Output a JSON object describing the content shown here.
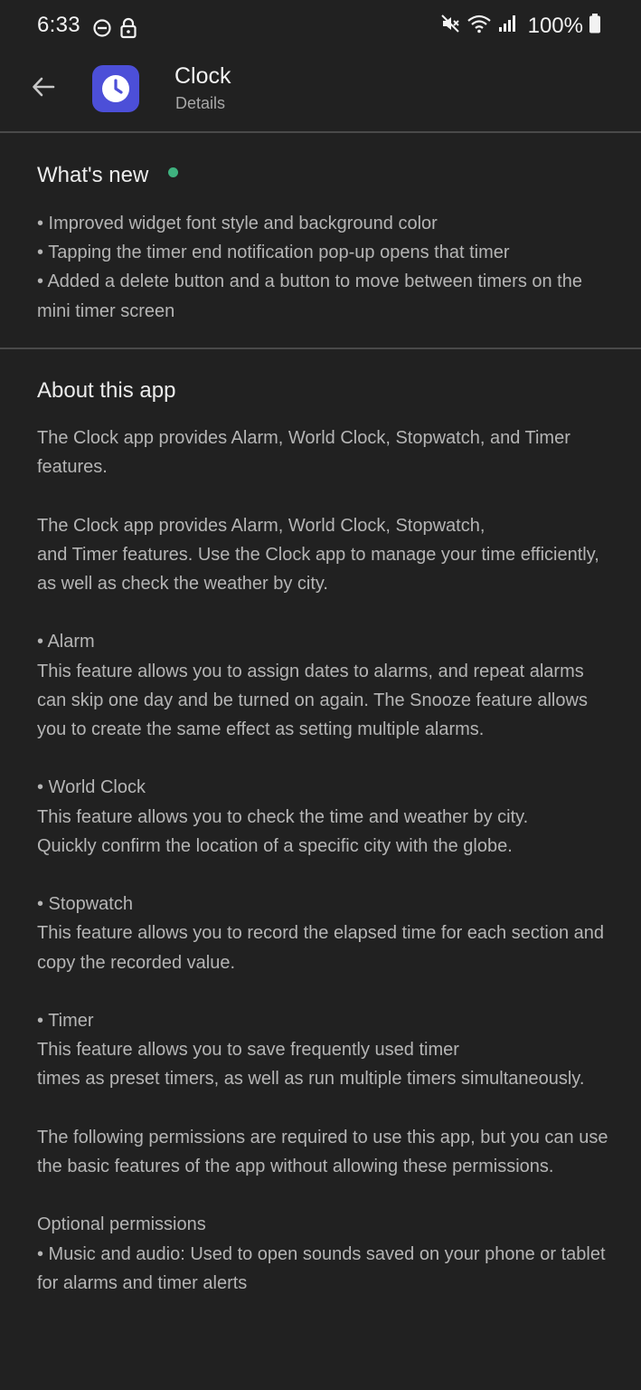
{
  "status_bar": {
    "time": "6:33",
    "left_icons": [
      "do-not-disturb-icon",
      "lock-icon"
    ],
    "right_icons": [
      "mute-icon",
      "wifi-icon",
      "signal-icon",
      "battery-icon"
    ],
    "battery": "100%"
  },
  "header": {
    "back_icon": "arrow-left-icon",
    "app_name": "Clock",
    "subtitle": "Details",
    "app_icon_color": "#4c4fd8"
  },
  "whats_new": {
    "title": "What's new",
    "indicator_color": "#3fb27f",
    "text": "• Improved widget font style and background color\n• Tapping the timer end notification pop-up opens that timer\n• Added a delete button and a button to move between timers on the mini timer screen"
  },
  "about": {
    "title": "About this app",
    "text": "The Clock app provides Alarm, World Clock, Stopwatch, and Timer features.\n\nThe Clock app provides Alarm, World Clock, Stopwatch,\nand Timer features. Use the Clock app to manage your time efficiently, as well as check the weather by city.\n\n• Alarm\nThis feature allows you to assign dates to alarms, and repeat alarms can skip one day and be turned on again. The Snooze feature allows you to create the same effect as setting multiple alarms.\n\n• World Clock\nThis feature allows you to check the time and weather by city.\nQuickly confirm the location of a specific city with the globe.\n\n• Stopwatch\nThis feature allows you to record the elapsed time for each section and copy the recorded value.\n\n• Timer\nThis feature allows you to save frequently used timer\ntimes as preset timers, as well as run multiple timers simultaneously.\n\nThe following permissions are required to use this app, but you can use the basic features of the app without allowing these permissions.\n\nOptional permissions\n• Music and audio: Used to open sounds saved on your phone or tablet for alarms and timer alerts"
  }
}
